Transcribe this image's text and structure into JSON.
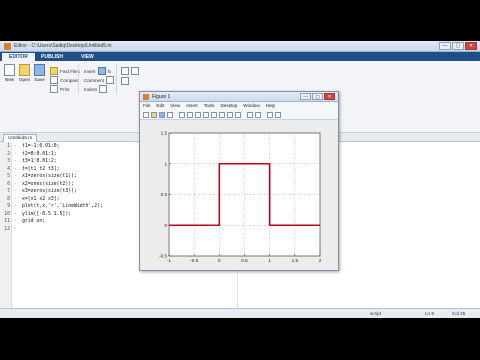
{
  "editor_window": {
    "title": "Editor - C:\\Users\\Sadiq\\Desktop\\Untitled5.m",
    "minimize": "—",
    "maximize": "▢",
    "close": "✕"
  },
  "ribbon_tabs": [
    "EDITOR",
    "PUBLISH",
    "VIEW"
  ],
  "ribbon": {
    "new": "New",
    "open": "Open",
    "save": "Save",
    "find_files": "Find Files",
    "compare": "Compare",
    "print": "Print",
    "insert": "Insert",
    "comment": "Comment",
    "indent": "Indent",
    "fx": "fx"
  },
  "doc_tab": "Untitled5.m",
  "code_lines": [
    "t1=-1:0.01:0;",
    "t2=0:0.01:1;",
    "t3=1:0.01:2;",
    "t=[t1 t2 t3];",
    "x1=zeros(size(t1));",
    "x2=ones(size(t2));",
    "x3=zeros(size(t3));",
    "x=[x1 x2 x3];",
    "plot(t,x,'r','LineWidth',2);",
    "ylim([-0.5 1.5]);",
    "grid on;",
    ""
  ],
  "status": {
    "mode": "script",
    "ln_label": "Ln 9",
    "col_label": "Col 25"
  },
  "figure_window": {
    "title": "Figure 1",
    "menu": [
      "File",
      "Edit",
      "View",
      "Insert",
      "Tools",
      "Desktop",
      "Window",
      "Help"
    ]
  },
  "chart_data": {
    "type": "line",
    "title": "",
    "xlabel": "",
    "ylabel": "",
    "x": [
      -1,
      0,
      0,
      1,
      1,
      2
    ],
    "series": [
      {
        "values": [
          0,
          0,
          1,
          1,
          0,
          0
        ],
        "color": "#c0001a"
      }
    ],
    "xlim": [
      -1,
      2
    ],
    "ylim": [
      -0.5,
      1.5
    ],
    "xticks": [
      -1,
      -0.5,
      0,
      0.5,
      1,
      1.5,
      2
    ],
    "yticks": [
      -0.5,
      0,
      0.5,
      1,
      1.5
    ],
    "xtick_labels": [
      "-1",
      "-0.5",
      "0",
      "0.5",
      "1",
      "1.5",
      "2"
    ],
    "ytick_labels": [
      "-0.5",
      "0",
      "0.5",
      "1",
      "1.5"
    ],
    "grid": true
  }
}
